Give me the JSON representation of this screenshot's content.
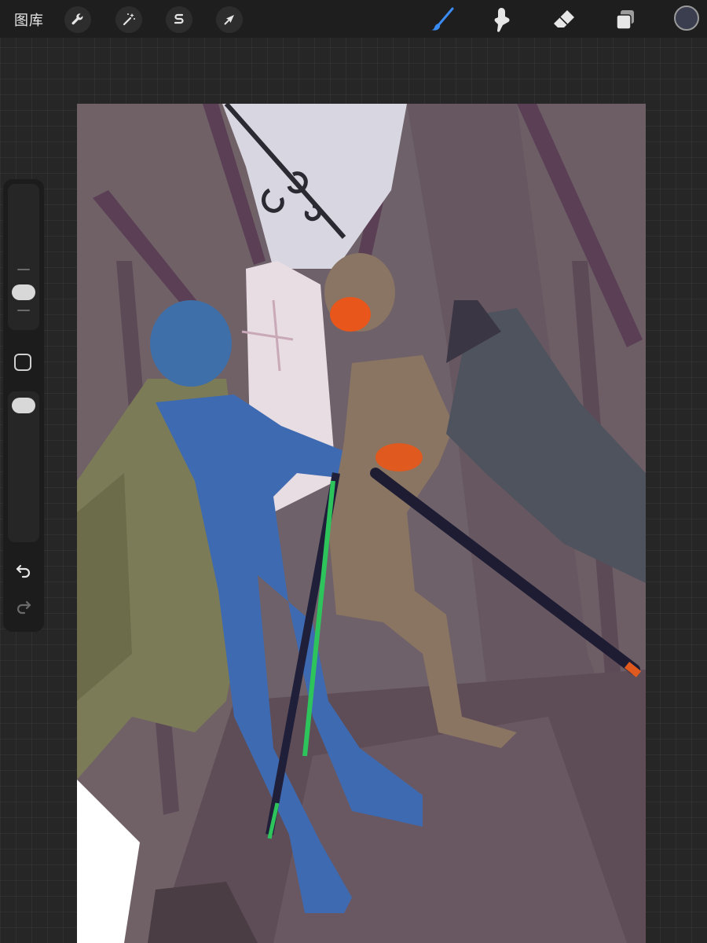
{
  "toolbar": {
    "gallery_label": "图库",
    "left_tools": [
      "wrench-icon",
      "magic-wand-icon",
      "selection-s-icon",
      "transform-arrow-icon"
    ],
    "right_tools": [
      "brush-icon",
      "smudge-icon",
      "eraser-icon",
      "layers-icon"
    ],
    "active_tool": "brush",
    "accent_color": "#3b8cf2",
    "current_color": "#3b3e4e"
  },
  "sidebar": {
    "brush_size_slider": 0.18,
    "opacity_slider": 0.0,
    "controls": [
      "brush-size-slider",
      "modifier-button",
      "opacity-slider",
      "undo-icon",
      "redo-icon"
    ]
  }
}
